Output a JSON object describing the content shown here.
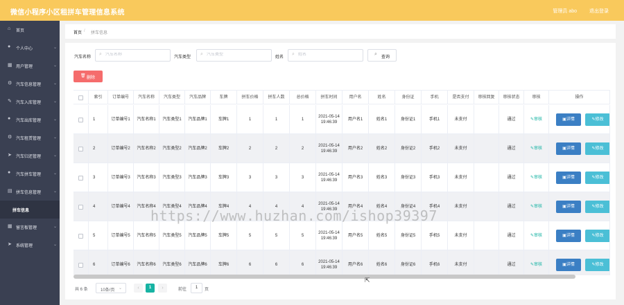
{
  "app": {
    "title": "微信小程序小区租拼车管理信息系统",
    "user_label": "管理员 abo",
    "logout": "退出登录"
  },
  "sidebar": {
    "items": [
      {
        "label": "首页",
        "icon": "home-icon",
        "glyph": "⌂"
      },
      {
        "label": "个人中心",
        "icon": "user-icon",
        "glyph": "●"
      },
      {
        "label": "用户管理",
        "icon": "grid-icon",
        "glyph": "▦"
      },
      {
        "label": "汽车信息管理",
        "icon": "gear-icon",
        "glyph": "⚙"
      },
      {
        "label": "汽车入库管理",
        "icon": "edit-icon",
        "glyph": "✎"
      },
      {
        "label": "汽车出库管理",
        "icon": "user-icon",
        "glyph": "●"
      },
      {
        "label": "汽车租赁管理",
        "icon": "gear-icon",
        "glyph": "⚙"
      },
      {
        "label": "汽车归还管理",
        "icon": "send-icon",
        "glyph": "➤"
      },
      {
        "label": "汽车拼车管理",
        "icon": "user-icon",
        "glyph": "●"
      },
      {
        "label": "拼车信息管理",
        "icon": "grid-icon",
        "glyph": "▤"
      },
      {
        "label": "拼车信息",
        "sub": true
      },
      {
        "label": "留言板管理",
        "icon": "grid-icon",
        "glyph": "▦"
      },
      {
        "label": "系统管理",
        "icon": "send-icon",
        "glyph": "➤"
      }
    ]
  },
  "breadcrumb": {
    "home": "首页",
    "sep": "/",
    "current": "拼车信息"
  },
  "filters": {
    "car_name": {
      "label": "汽车名称",
      "placeholder": "汽车名称"
    },
    "car_type": {
      "label": "汽车类型",
      "placeholder": "汽车类型"
    },
    "name": {
      "label": "姓名",
      "placeholder": "姓名"
    },
    "query": "查询"
  },
  "delete_button": "删除",
  "table": {
    "headers": [
      "",
      "索引",
      "订单编号",
      "汽车名称",
      "汽车类型",
      "汽车品牌",
      "车牌",
      "拼车价格",
      "拼车人数",
      "总价格",
      "拼车时间",
      "用户名",
      "姓名",
      "身份证",
      "手机",
      "是否支付",
      "审核回复",
      "审核状态",
      "审核",
      "操作"
    ],
    "audit_label": "审核",
    "detail_label": "详情",
    "edit_label": "修改",
    "rows": [
      [
        "1",
        "订单编号1",
        "汽车名称1",
        "汽车类型1",
        "汽车品牌1",
        "车牌1",
        "1",
        "1",
        "1",
        "2021-05-14 19:46:39",
        "用户名1",
        "姓名1",
        "身份证1",
        "手机1",
        "未支付",
        "",
        "通过"
      ],
      [
        "2",
        "订单编号2",
        "汽车名称2",
        "汽车类型2",
        "汽车品牌2",
        "车牌2",
        "2",
        "2",
        "2",
        "2021-05-14 19:46:39",
        "用户名2",
        "姓名2",
        "身份证2",
        "手机2",
        "未支付",
        "",
        "通过"
      ],
      [
        "3",
        "订单编号3",
        "汽车名称3",
        "汽车类型3",
        "汽车品牌3",
        "车牌3",
        "3",
        "3",
        "3",
        "2021-05-14 19:46:39",
        "用户名3",
        "姓名3",
        "身份证3",
        "手机3",
        "未支付",
        "",
        "通过"
      ],
      [
        "4",
        "订单编号4",
        "汽车名称4",
        "汽车类型4",
        "汽车品牌4",
        "车牌4",
        "4",
        "4",
        "4",
        "2021-05-14 19:46:39",
        "用户名4",
        "姓名4",
        "身份证4",
        "手机4",
        "未支付",
        "",
        "通过"
      ],
      [
        "5",
        "订单编号5",
        "汽车名称5",
        "汽车类型5",
        "汽车品牌5",
        "车牌5",
        "5",
        "5",
        "5",
        "2021-05-14 19:46:39",
        "用户名5",
        "姓名5",
        "身份证5",
        "手机5",
        "未支付",
        "",
        "通过"
      ],
      [
        "6",
        "订单编号6",
        "汽车名称6",
        "汽车类型6",
        "汽车品牌6",
        "车牌6",
        "6",
        "6",
        "6",
        "2021-05-14 19:46:39",
        "用户名6",
        "姓名6",
        "身份证6",
        "手机6",
        "未支付",
        "",
        "通过"
      ]
    ]
  },
  "pager": {
    "total": "共 6 条",
    "page_size": "10条/页",
    "current_page": "1",
    "goto_label": "前往",
    "goto_value": "1",
    "page_suffix": "页"
  },
  "watermark": "https://www.huzhan.com/ishop39397",
  "colors": {
    "topbar": "#f9c95c",
    "sidebar": "#3a4052",
    "accent": "#17b3a3",
    "danger": "#f56c6c",
    "detail": "#3b7fc4",
    "edit": "#4bbfd6"
  }
}
